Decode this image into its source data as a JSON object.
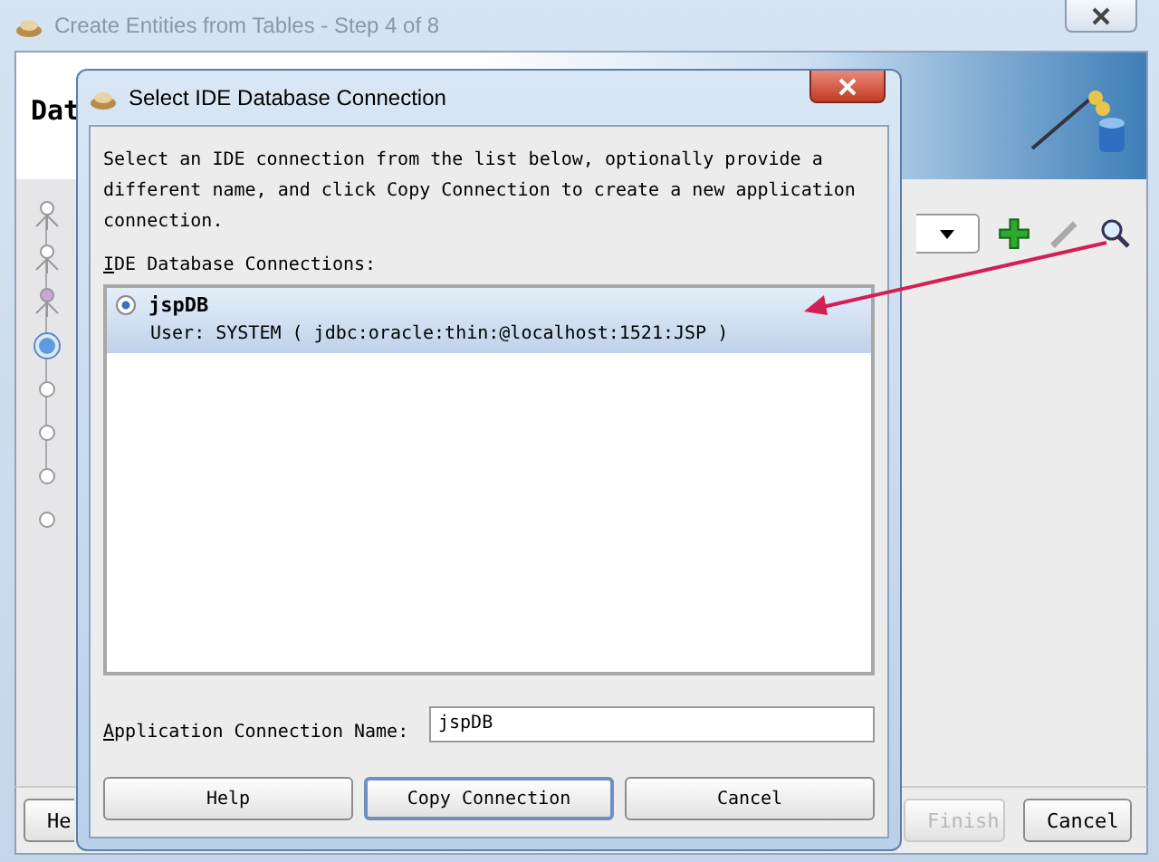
{
  "background_window": {
    "title": "Create Entities from Tables - Step 4 of 8",
    "header_title": "Dat",
    "steps": [
      {
        "kind": "done"
      },
      {
        "kind": "done"
      },
      {
        "kind": "done"
      },
      {
        "kind": "current"
      },
      {
        "kind": "todo"
      },
      {
        "kind": "todo"
      },
      {
        "kind": "todo"
      },
      {
        "kind": "todo"
      }
    ],
    "buttons": [
      {
        "label": "He",
        "disabled": false
      },
      {
        "label": "Finish",
        "disabled": true
      },
      {
        "label": "Cancel",
        "disabled": false
      }
    ]
  },
  "dialog": {
    "title": "Select IDE Database Connection",
    "instructions": "Select an IDE connection from the list below, optionally provide a different name, and click Copy Connection to create a new application connection.",
    "list_label": "IDE Database Connections:",
    "connections": [
      {
        "name": "jspDB",
        "details": "User: SYSTEM ( jdbc:oracle:thin:@localhost:1521:JSP )",
        "selected": true
      }
    ],
    "name_label": "Application Connection Name:",
    "name_value": "jspDB",
    "buttons": [
      {
        "label": "Help",
        "default": false
      },
      {
        "label": "Copy Connection",
        "default": true
      },
      {
        "label": "Cancel",
        "default": false
      }
    ]
  }
}
